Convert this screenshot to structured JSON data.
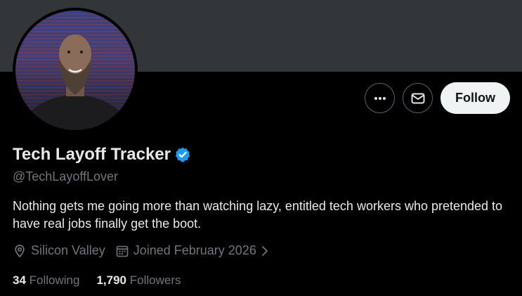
{
  "profile": {
    "display_name": "Tech Layoff Tracker",
    "handle": "@TechLayoffLover",
    "bio": "Nothing gets me going more than watching lazy, entitled tech workers who pretended to have real jobs finally get the boot.",
    "location": "Silicon Valley",
    "joined": "Joined February 2026",
    "verified_color": "#1d9bf0"
  },
  "actions": {
    "more_icon": "more-icon",
    "message_icon": "mail-icon",
    "follow_label": "Follow"
  },
  "stats": {
    "following_count": "34",
    "following_label": "Following",
    "followers_count": "1,790",
    "followers_label": "Followers"
  }
}
